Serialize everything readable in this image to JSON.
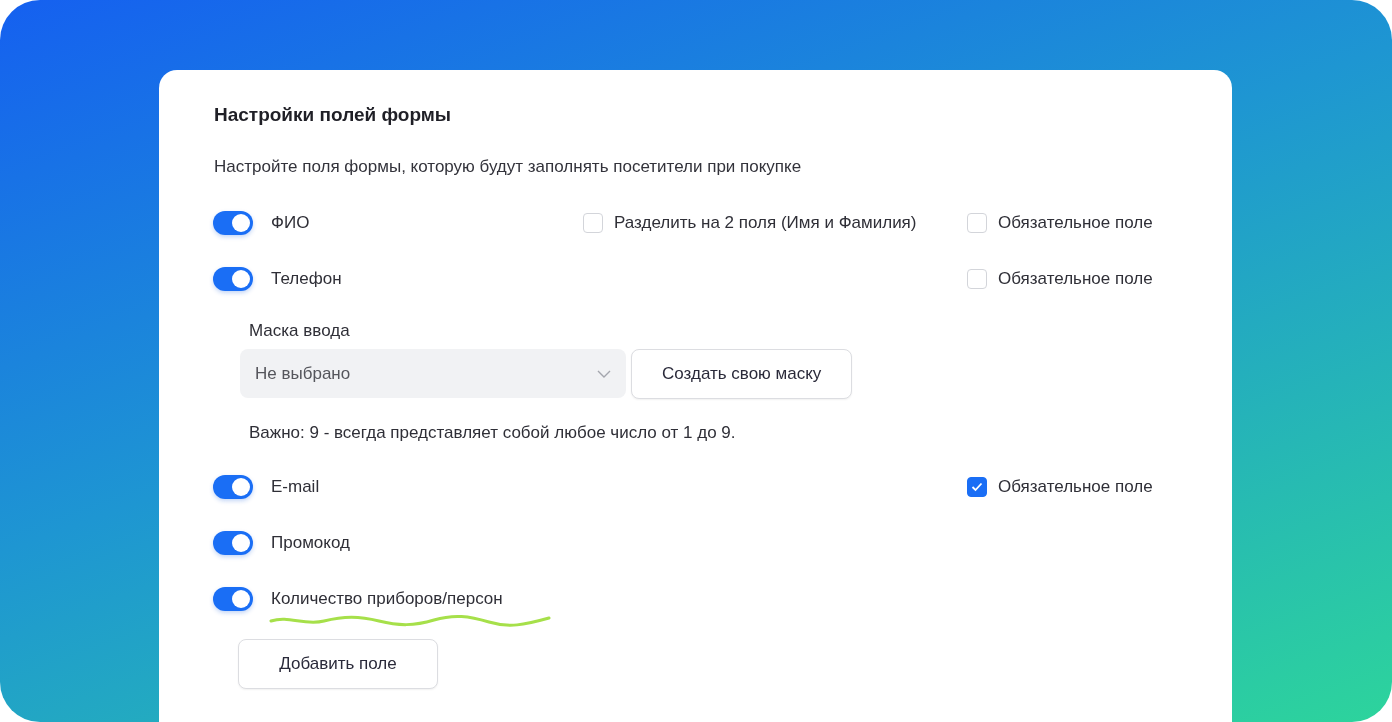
{
  "title": "Настройки полей формы",
  "description": "Настройте поля формы, которую будут заполнять посетители при покупке",
  "fields": [
    {
      "label": "ФИО",
      "enabled": true,
      "split": {
        "label": "Разделить на 2 поля (Имя и Фамилия)",
        "checked": false
      },
      "required": {
        "label": "Обязательное поле",
        "checked": false
      }
    },
    {
      "label": "Телефон",
      "enabled": true,
      "required": {
        "label": "Обязательное поле",
        "checked": false
      },
      "mask": {
        "label": "Маска ввода",
        "select": {
          "value": "Не выбрано"
        },
        "button": "Создать свою маску",
        "note": "Важно: 9 - всегда представляет собой любое число от 1 до 9."
      }
    },
    {
      "label": "E-mail",
      "enabled": true,
      "required": {
        "label": "Обязательное поле",
        "checked": true
      }
    },
    {
      "label": "Промокод",
      "enabled": true
    },
    {
      "label": "Количество приборов/персон",
      "enabled": true,
      "highlighted": true
    }
  ],
  "add_button": "Добавить поле"
}
